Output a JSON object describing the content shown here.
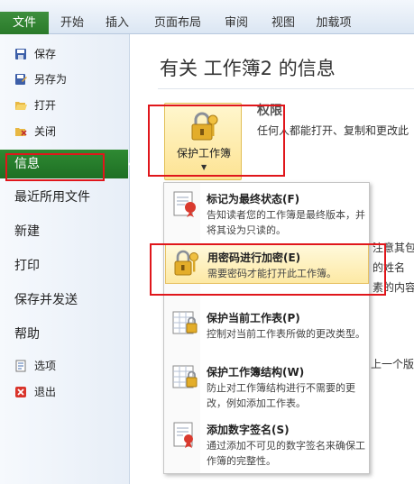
{
  "ribbon": {
    "file_tab": "文件",
    "tabs": [
      "开始",
      "插入",
      "页面布局",
      "审阅",
      "视图",
      "加载项"
    ]
  },
  "sidebar": {
    "small_items": [
      {
        "label": "保存",
        "icon": "save-icon"
      },
      {
        "label": "另存为",
        "icon": "save-as-icon"
      },
      {
        "label": "打开",
        "icon": "open-folder-icon"
      },
      {
        "label": "关闭",
        "icon": "close-folder-icon"
      }
    ],
    "active": "信息",
    "big_items": [
      "最近所用文件",
      "新建",
      "打印",
      "保存并发送",
      "帮助"
    ],
    "bottom_items": [
      {
        "label": "选项",
        "icon": "options-icon"
      },
      {
        "label": "退出",
        "icon": "exit-icon"
      }
    ]
  },
  "main": {
    "title": "有关 工作簿2 的信息",
    "protect_button": "保护工作簿",
    "permissions_title": "权限",
    "permissions_desc": "任何人都能打开、复制和更改此",
    "bg_fragments": [
      "注意其包含",
      "的姓名",
      "素的内容",
      "上一个版本"
    ]
  },
  "menu": {
    "items": [
      {
        "title": "标记为最终状态(F)",
        "desc": "告知读者您的工作簿是最终版本，并将其设为只读的。",
        "icon": "mark-final-icon"
      },
      {
        "title": "用密码进行加密(E)",
        "desc": "需要密码才能打开此工作簿。",
        "icon": "encrypt-password-icon"
      },
      {
        "title": "保护当前工作表(P)",
        "desc": "控制对当前工作表所做的更改类型。",
        "icon": "protect-sheet-icon"
      },
      {
        "title": "保护工作簿结构(W)",
        "desc": "防止对工作簿结构进行不需要的更改，例如添加工作表。",
        "icon": "protect-structure-icon"
      },
      {
        "title": "添加数字签名(S)",
        "desc": "通过添加不可见的数字签名来确保工作簿的完整性。",
        "icon": "digital-signature-icon"
      }
    ]
  },
  "colors": {
    "file_tab": "#2a7a2a",
    "active_item": "#1e6f24",
    "highlight_box": "#e0161b",
    "menu_highlight": "#fde9a4"
  }
}
